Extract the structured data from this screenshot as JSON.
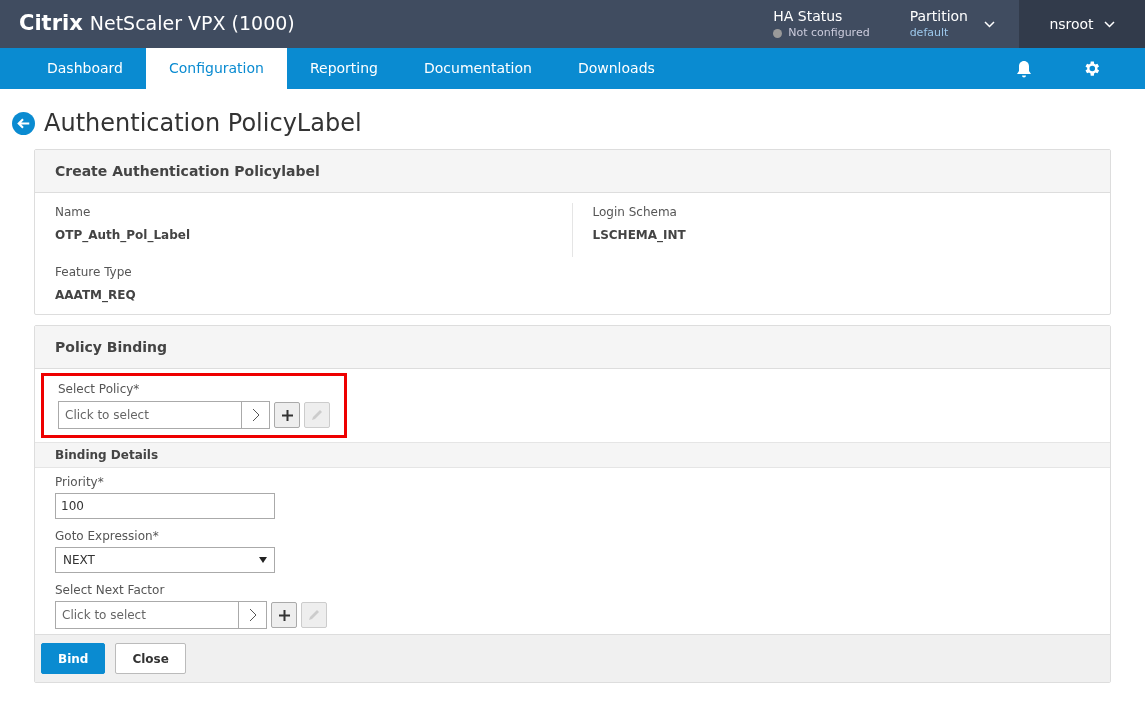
{
  "header": {
    "brand": "Citrix",
    "product": "NetScaler VPX (1000)",
    "ha_status": {
      "label": "HA Status",
      "value": "Not configured"
    },
    "partition": {
      "label": "Partition",
      "value": "default"
    },
    "user": "nsroot"
  },
  "nav": {
    "tabs": [
      {
        "label": "Dashboard",
        "selected": false
      },
      {
        "label": "Configuration",
        "selected": true
      },
      {
        "label": "Reporting",
        "selected": false
      },
      {
        "label": "Documentation",
        "selected": false
      },
      {
        "label": "Downloads",
        "selected": false
      }
    ]
  },
  "page_title": "Authentication PolicyLabel",
  "summary": {
    "title": "Create Authentication Policylabel",
    "fields": [
      {
        "label": "Name",
        "value": "OTP_Auth_Pol_Label"
      },
      {
        "label": "Login Schema",
        "value": "LSCHEMA_INT"
      },
      {
        "label": "Feature Type",
        "value": "AAATM_REQ"
      }
    ]
  },
  "policy_binding": {
    "title": "Policy Binding",
    "select_policy": {
      "label": "Select Policy*",
      "placeholder": "Click to select",
      "highlighted": true
    },
    "binding_details": {
      "title": "Binding Details",
      "priority": {
        "label": "Priority*",
        "value": "100"
      },
      "goto_expression": {
        "label": "Goto Expression*",
        "value": "NEXT"
      },
      "next_factor": {
        "label": "Select Next Factor",
        "placeholder": "Click to select"
      }
    }
  },
  "buttons": [
    {
      "label": "Bind",
      "kind": "primary"
    },
    {
      "label": "Close",
      "kind": "secondary"
    }
  ]
}
